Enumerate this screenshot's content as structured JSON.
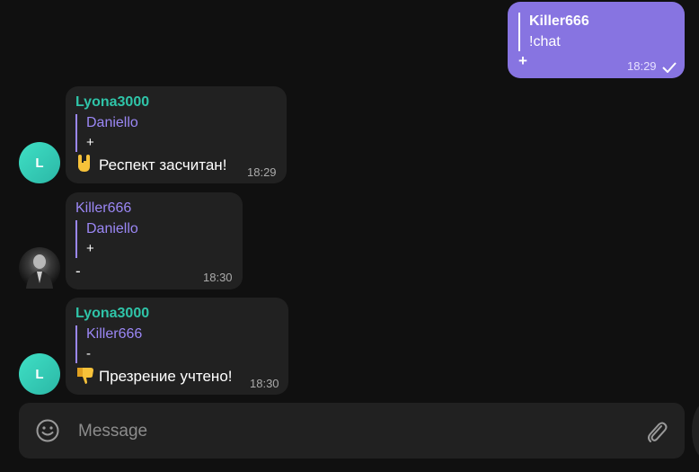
{
  "colors": {
    "accent": "#8774e1",
    "green_name": "#2fc4a8",
    "purple_name": "#9b87f5",
    "bubble_in": "#212121"
  },
  "messages": [
    {
      "direction": "out",
      "quote_name": "Killer666",
      "quote_text": "!chat",
      "text": "+",
      "time": "18:29",
      "status_icon": "check-icon"
    },
    {
      "direction": "in",
      "sender": "Lyona3000",
      "avatar_letter": "L",
      "quote_name": "Daniello",
      "quote_text": "+",
      "emoji": "sign-of-horns-emoji",
      "text": "Респект засчитан!",
      "time": "18:29"
    },
    {
      "direction": "in",
      "sender": "Killer666",
      "avatar_icon": "user-photo-avatar",
      "quote_name": "Daniello",
      "quote_text": "+",
      "text": "-",
      "time": "18:30"
    },
    {
      "direction": "in",
      "sender": "Lyona3000",
      "avatar_letter": "L",
      "quote_name": "Killer666",
      "quote_text": "-",
      "emoji": "thumbs-down-emoji",
      "text": "Презрение учтено!",
      "time": "18:30"
    }
  ],
  "composer": {
    "placeholder": "Message",
    "emoji_icon": "smile-icon",
    "attach_icon": "paperclip-icon"
  }
}
